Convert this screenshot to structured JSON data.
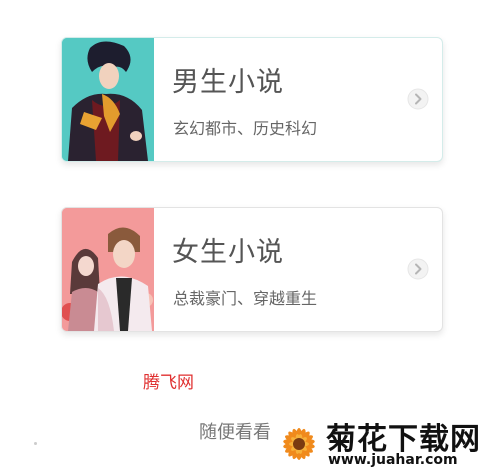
{
  "categories": [
    {
      "title": "男生小说",
      "subtitle": "玄幻都市、历史科幻",
      "icon": "chevron-right-icon"
    },
    {
      "title": "女生小说",
      "subtitle": "总裁豪门、穿越重生",
      "icon": "chevron-right-icon"
    }
  ],
  "site_label": "腾飞网",
  "random_link": "随便看看",
  "watermark": {
    "title": "菊花下载网",
    "url": "www.juahar.com"
  },
  "colors": {
    "male_cover_bg": "#55c9c3",
    "female_cover_bg": "#f39a9a",
    "site_label": "#e03030"
  }
}
